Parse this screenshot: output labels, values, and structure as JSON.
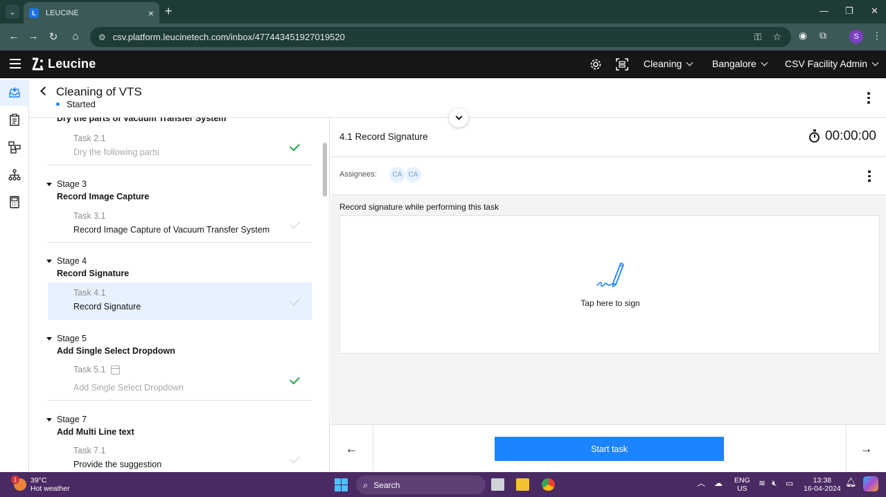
{
  "browser": {
    "tab_title": "LEUCINE",
    "tab_favicon": "L",
    "url": "csv.platform.leucinetech.com/inbox/477443451927019520",
    "profile_initial": "S"
  },
  "appbar": {
    "brand": "Leucine",
    "use_case": "Cleaning",
    "facility": "Bangalore",
    "user": "CSV Facility Admin"
  },
  "page": {
    "title": "Cleaning of VTS",
    "status": "Started",
    "status_color": "#1d84ff"
  },
  "tasklist": {
    "partial_stage_name": "Dry the parts of Vacuum Transfer System",
    "stages": [
      {
        "label": "Stage 3",
        "name": "Record Image Capture"
      },
      {
        "label": "Stage 4",
        "name": "Record Signature"
      },
      {
        "label": "Stage 5",
        "name": "Add Single Select Dropdown"
      },
      {
        "label": "Stage 7",
        "name": "Add Multi Line text"
      }
    ],
    "tasks": [
      {
        "label": "Task 2.1",
        "name": "Dry the following parts",
        "status": "completed"
      },
      {
        "label": "Task 3.1",
        "name": "Record Image Capture of Vacuum Transfer System",
        "status": "pending"
      },
      {
        "label": "Task 4.1",
        "name": "Record Signature",
        "status": "selected"
      },
      {
        "label": "Task 5.1",
        "name": "Add Single Select Dropdown",
        "status": "completed"
      },
      {
        "label": "Task 7.1",
        "name": "Provide the suggestion",
        "status": "pending"
      }
    ]
  },
  "task_panel": {
    "title": "4.1 Record Signature",
    "timer": "00:00:00",
    "assignees_label": "Assignees:",
    "assignees": [
      "CA",
      "CA"
    ],
    "signature_label": "Record signature while performing this task",
    "signature_prompt": "Tap here to sign",
    "start_button": "Start task",
    "prev_arrow": "←",
    "next_arrow": "→"
  },
  "taskbar": {
    "weather_temp": "39°C",
    "weather_desc": "Hot weather",
    "weather_badge": "1",
    "search": "Search",
    "lang_1": "ENG",
    "lang_2": "US",
    "time": "13:38",
    "date": "16-04-2024"
  },
  "colors": {
    "primary": "#1d84ff",
    "success": "#24a148",
    "header_bg": "#161616",
    "selected_bg": "#e7f1ff"
  }
}
